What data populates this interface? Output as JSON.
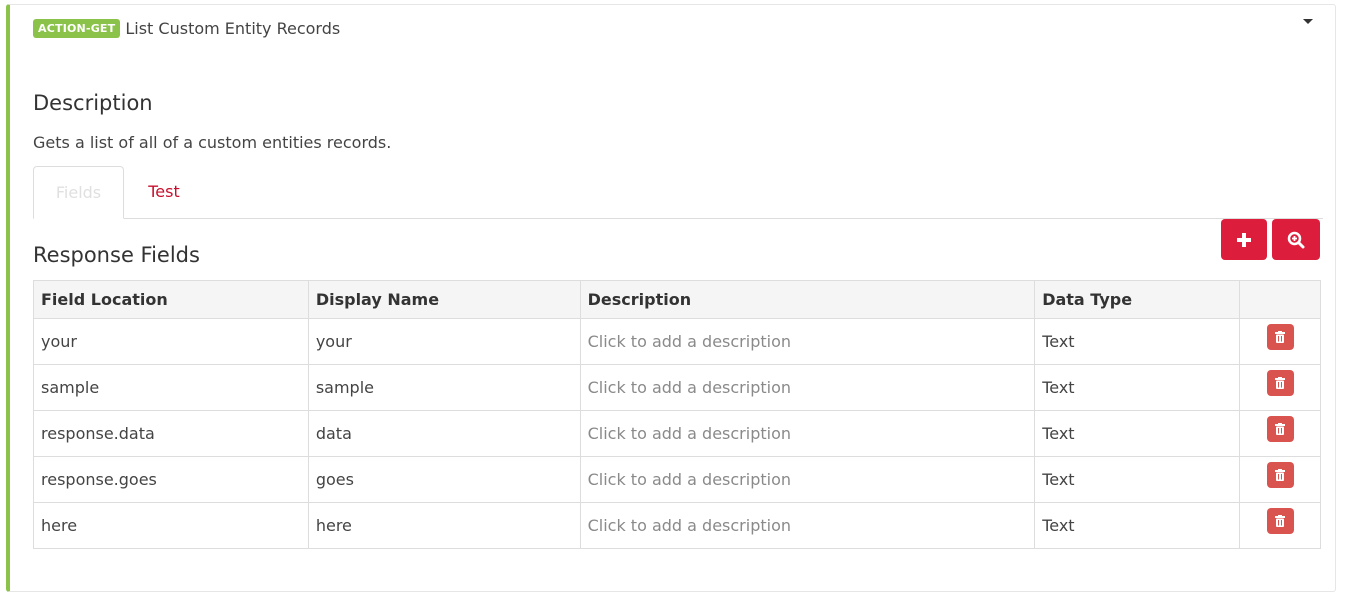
{
  "header": {
    "badge": "ACTION-GET",
    "title": "List Custom Entity Records"
  },
  "description": {
    "title": "Description",
    "text": "Gets a list of all of a custom entities records."
  },
  "tabs": [
    {
      "label": "Fields",
      "active": true
    },
    {
      "label": "Test",
      "active": false
    }
  ],
  "response": {
    "title": "Response Fields",
    "buttons": {
      "add_icon": "plus-icon",
      "zoom_icon": "zoom-in-icon"
    }
  },
  "table": {
    "headers": [
      "Field Location",
      "Display Name",
      "Description",
      "Data Type",
      ""
    ],
    "rows": [
      {
        "location": "your",
        "display": "your",
        "description": "Click to add a description",
        "type": "Text"
      },
      {
        "location": "sample",
        "display": "sample",
        "description": "Click to add a description",
        "type": "Text"
      },
      {
        "location": "response.data",
        "display": "data",
        "description": "Click to add a description",
        "type": "Text"
      },
      {
        "location": "response.goes",
        "display": "goes",
        "description": "Click to add a description",
        "type": "Text"
      },
      {
        "location": "here",
        "display": "here",
        "description": "Click to add a description",
        "type": "Text"
      }
    ]
  },
  "colors": {
    "accent_green": "#8bc34a",
    "primary_red": "#dc1e3c",
    "delete_red": "#d9534f",
    "tab_link": "#c8102e"
  }
}
